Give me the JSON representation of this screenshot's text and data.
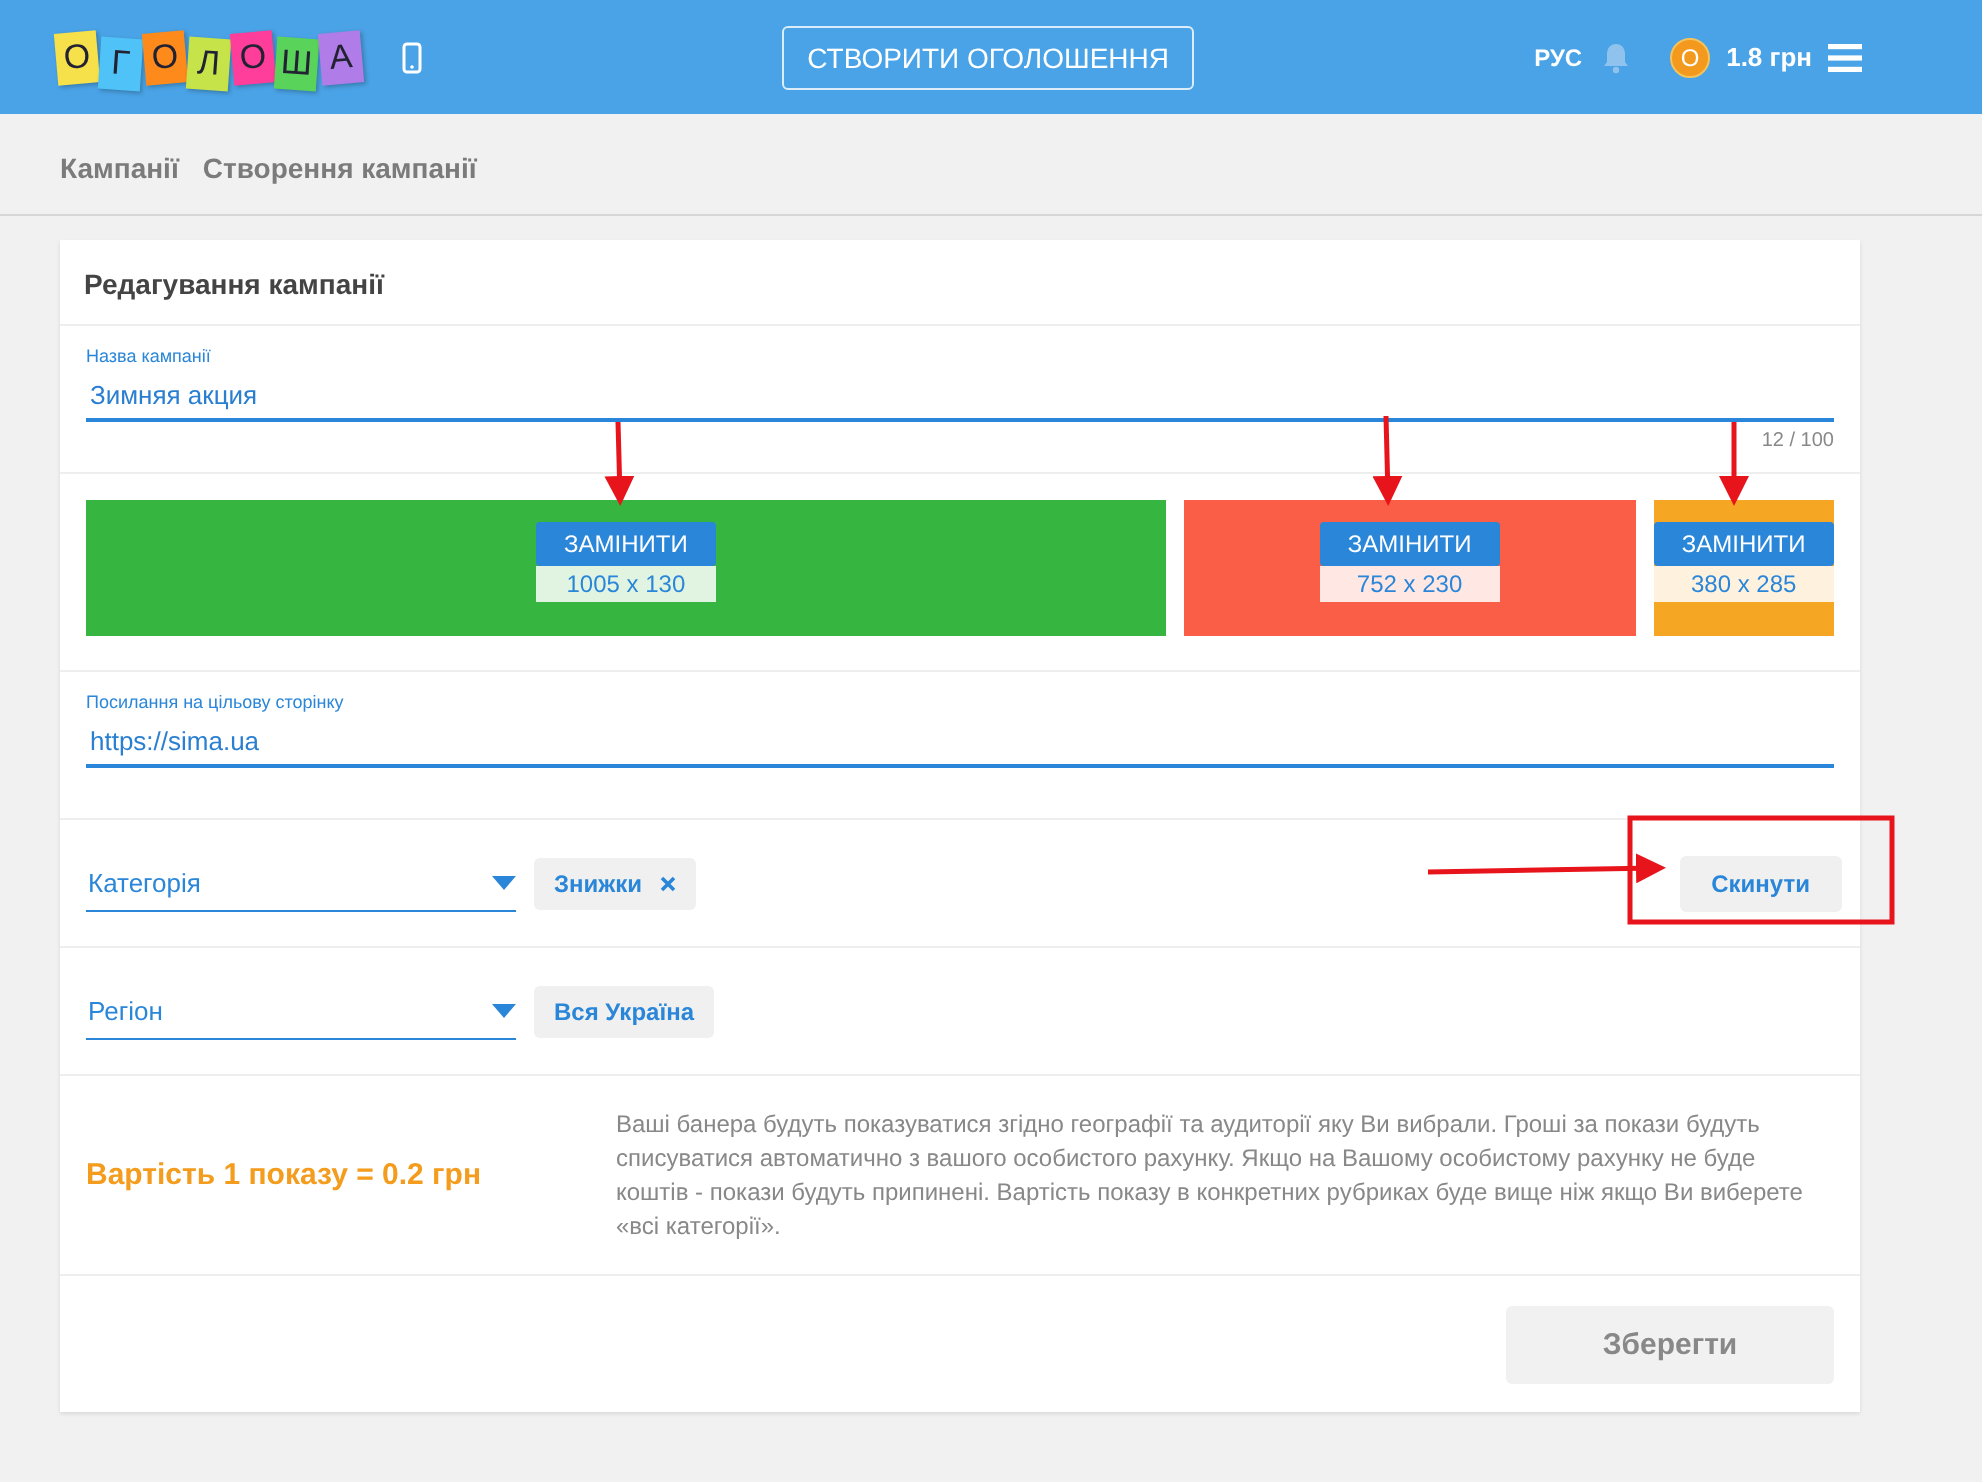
{
  "header": {
    "logo_letters": [
      {
        "char": "О",
        "color": "#f7e14a"
      },
      {
        "char": "Г",
        "color": "#4fc3f7"
      },
      {
        "char": "О",
        "color": "#ff8a1c"
      },
      {
        "char": "Л",
        "color": "#c6e34a"
      },
      {
        "char": "О",
        "color": "#ff3d9a"
      },
      {
        "char": "Ш",
        "color": "#5ad35a"
      },
      {
        "char": "А",
        "color": "#b07de8"
      }
    ],
    "create_button": "СТВОРИТИ ОГОЛОШЕННЯ",
    "language": "РУС",
    "coin_letter": "О",
    "balance": "1.8 грн"
  },
  "breadcrumbs": [
    "Кампанії",
    "Створення кампанії"
  ],
  "card": {
    "title": "Редагування кампанії",
    "name_field": {
      "label": "Назва кампанії",
      "value": "Зимняя акция",
      "counter": "12 / 100"
    },
    "banners": [
      {
        "color": "#36b541",
        "button": "ЗАМІНИТИ",
        "size": "1005 x 130"
      },
      {
        "color": "#fb5e47",
        "button": "ЗАМІНИТИ",
        "size": "752 x 230"
      },
      {
        "color": "#f5a623",
        "button": "ЗАМІНИТИ",
        "size": "380 x 285"
      }
    ],
    "link_field": {
      "label": "Посилання на цільову сторінку",
      "value": "https://sima.ua"
    },
    "category": {
      "placeholder": "Категорія",
      "chips": [
        {
          "label": "Знижки",
          "removable": true
        }
      ],
      "reset_button": "Скинути"
    },
    "region": {
      "placeholder": "Регіон",
      "chips": [
        {
          "label": "Вся Україна",
          "removable": false
        }
      ]
    },
    "cost": "Вартість 1 показу = 0.2 грн",
    "note": "Ваші банера будуть показуватися згідно географії та аудиторії яку Ви вибрали. Гроші за покази будуть списуватися автоматично з вашого особистого рахунку. Якщо на Вашому особистому рахунку не буде коштів - покази будуть припинені. Вартість показу в конкретних рубриках буде вище ніж якщо Ви виберете «всі категорії».",
    "save_button": "Зберегти"
  }
}
